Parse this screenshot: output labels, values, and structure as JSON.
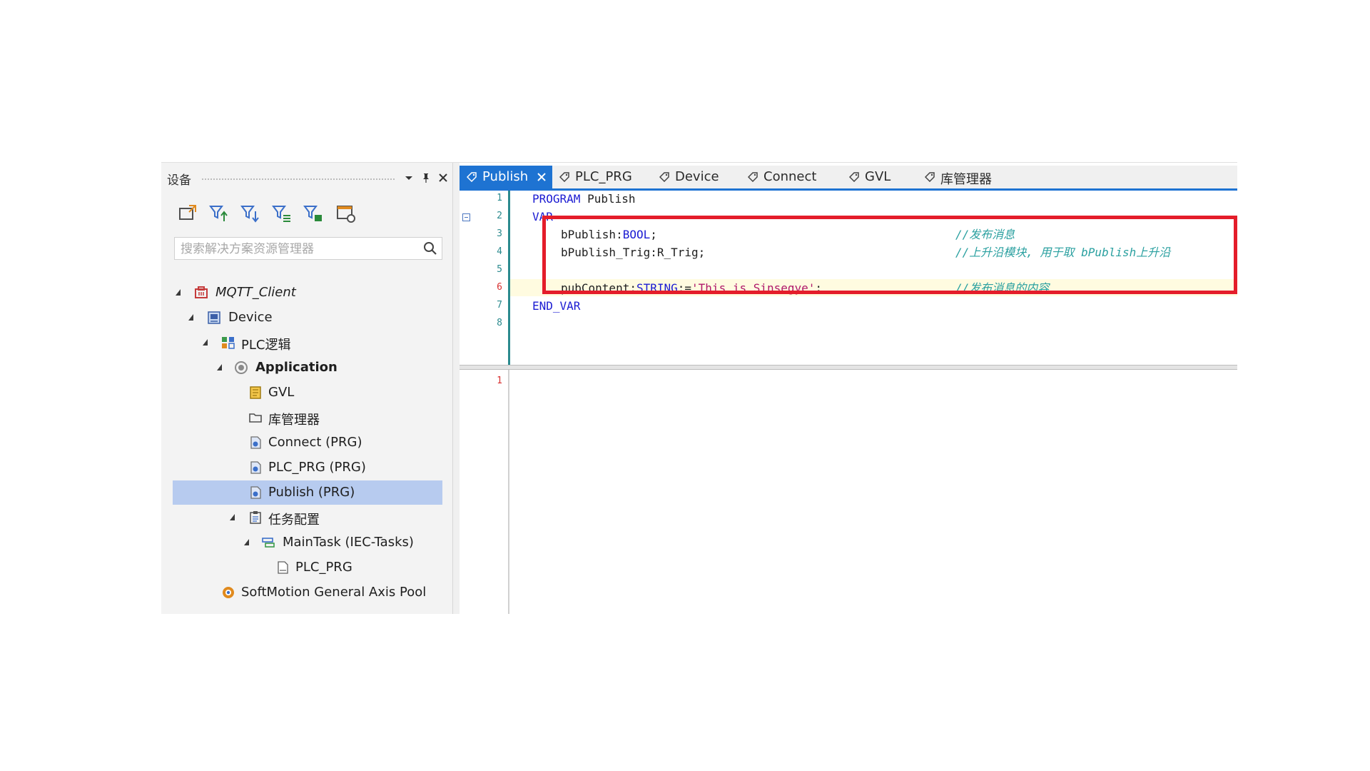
{
  "panel": {
    "title": "设备",
    "search_placeholder": "搜索解决方案资源管理器"
  },
  "tree": [
    {
      "label": "MQTT_Client",
      "icon": "project-icon"
    },
    {
      "label": "Device",
      "icon": "device-icon"
    },
    {
      "label": "PLC逻辑",
      "icon": "plc-logic-icon"
    },
    {
      "label": "Application",
      "icon": "application-icon"
    },
    {
      "label": "GVL",
      "icon": "gvl-icon"
    },
    {
      "label": "库管理器",
      "icon": "folder-icon"
    },
    {
      "label": "Connect (PRG)",
      "icon": "program-icon"
    },
    {
      "label": "PLC_PRG (PRG)",
      "icon": "program-icon"
    },
    {
      "label": "Publish (PRG)",
      "icon": "program-icon",
      "selected": true
    },
    {
      "label": "任务配置",
      "icon": "task-config-icon"
    },
    {
      "label": "MainTask (IEC-Tasks)",
      "icon": "task-icon"
    },
    {
      "label": "PLC_PRG",
      "icon": "program-call-icon"
    },
    {
      "label": "SoftMotion General Axis Pool",
      "icon": "softmotion-icon"
    }
  ],
  "tabs": [
    {
      "label": "Publish",
      "active": true
    },
    {
      "label": "PLC_PRG"
    },
    {
      "label": "Device"
    },
    {
      "label": "Connect"
    },
    {
      "label": "GVL"
    },
    {
      "label": "库管理器"
    }
  ],
  "code": {
    "line_numbers": [
      "1",
      "2",
      "3",
      "4",
      "5",
      "6",
      "7",
      "8"
    ],
    "line1": {
      "kw": "PROGRAM",
      "name": " Publish"
    },
    "line2": {
      "kw": "VAR"
    },
    "line3": {
      "var": "bPublish:",
      "type": "BOOL",
      "end": ";",
      "comment": "//发布消息"
    },
    "line4": {
      "var": "bPublish_Trig:R_Trig;",
      "comment": "//上升沿模块, 用于取 bPublish上升沿"
    },
    "line6": {
      "var": "pubContent:",
      "type": "STRING",
      "assign": ":=",
      "str": "'This is Sinsegye'",
      "end": ";",
      "comment": "//发布消息的内容"
    },
    "line7": {
      "kw": "END_VAR"
    },
    "impl_line_number": "1"
  },
  "colors": {
    "accent": "#1e73d2",
    "highlight_box": "#e41d2a",
    "selection": "#b7cbef"
  }
}
